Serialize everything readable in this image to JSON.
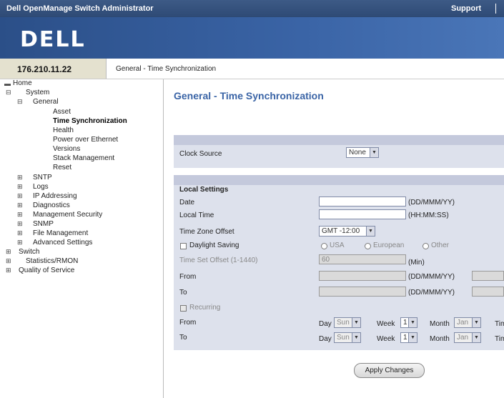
{
  "app": {
    "title": "Dell OpenManage Switch Administrator",
    "support": "Support",
    "logo": "DELL"
  },
  "ip": "176.210.11.22",
  "breadcrumb": "General - Time Synchronization",
  "tree": {
    "home": "Home",
    "system": "System",
    "general": "General",
    "asset": "Asset",
    "time_sync": "Time Synchronization",
    "health": "Health",
    "poe": "Power over Ethernet",
    "versions": "Versions",
    "stack": "Stack Management",
    "reset": "Reset",
    "sntp": "SNTP",
    "logs": "Logs",
    "ip_addressing": "IP Addressing",
    "diagnostics": "Diagnostics",
    "mgmt_security": "Management Security",
    "snmp": "SNMP",
    "file_mgmt": "File Management",
    "advanced": "Advanced Settings",
    "switch": "Switch",
    "statistics": "Statistics/RMON",
    "qos": "Quality of Service"
  },
  "page_title": "General - Time Synchronization",
  "clock": {
    "label": "Clock Source",
    "value": "None"
  },
  "local": {
    "heading": "Local Settings",
    "date_label": "Date",
    "date_fmt": "(DD/MMM/YY)",
    "date_value": "",
    "time_label": "Local Time",
    "time_fmt": "(HH:MM:SS)",
    "time_value": "",
    "tz_label": "Time Zone Offset",
    "tz_value": "GMT -12:00",
    "dst_label": "Daylight Saving",
    "dst_usa": "USA",
    "dst_european": "European",
    "dst_other": "Other",
    "offset_label": "Time Set Offset (1-1440)",
    "offset_value": "60",
    "offset_unit": "(Min)",
    "from_label": "From",
    "from_fmt": "(DD/MMM/YY)",
    "to_label": "To",
    "to_fmt": "(DD/MMM/YY)",
    "recurring_label": "Recurring",
    "rec_from_label": "From",
    "rec_to_label": "To",
    "day_label": "Day",
    "week_label": "Week",
    "month_label": "Month",
    "time_label2": "Time",
    "from_day": "Sun",
    "from_week": "1",
    "from_month": "Jan",
    "to_day": "Sun",
    "to_week": "1",
    "to_month": "Jan"
  },
  "apply_label": "Apply Changes"
}
